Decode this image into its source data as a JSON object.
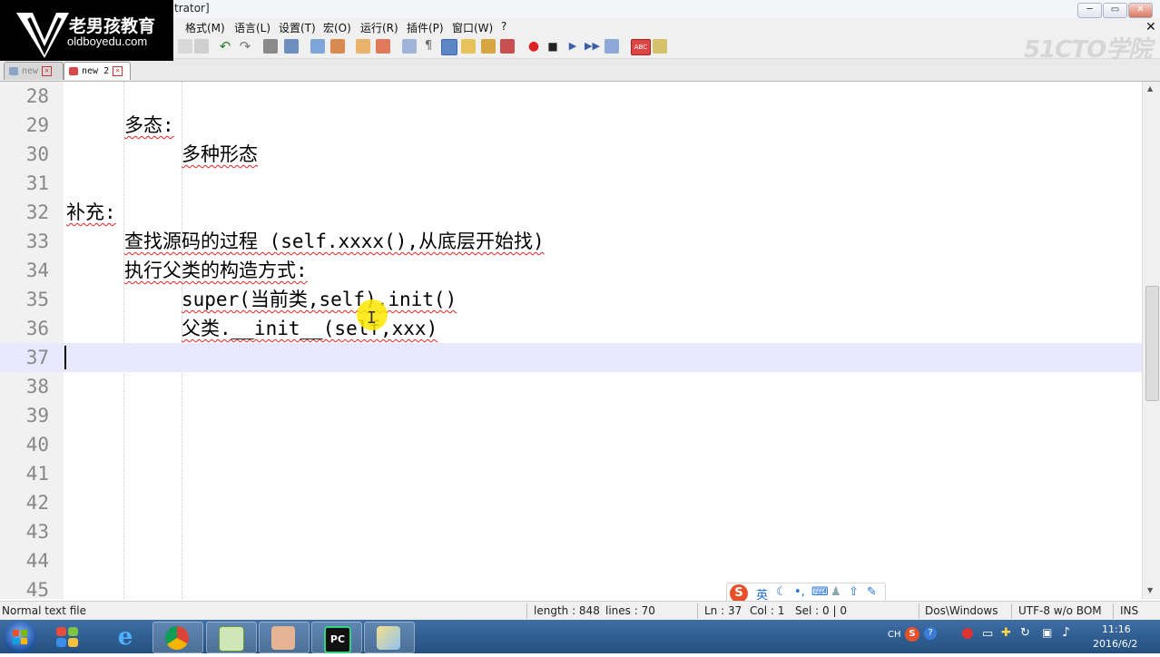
{
  "window": {
    "title_fragment": "trator]",
    "controls": [
      "─",
      "▭",
      "✕"
    ]
  },
  "logos": {
    "oldboy_cn": "老男孩教育",
    "oldboy_url": "oldboyedu.com",
    "cto": "51CTO学院"
  },
  "menu": [
    "格式(M)",
    "语言(L)",
    "设置(T)",
    "宏(O)",
    "运行(R)",
    "插件(P)",
    "窗口(W)",
    "?"
  ],
  "tabs": [
    {
      "label": "new",
      "active": false
    },
    {
      "label": "new  2",
      "active": true
    }
  ],
  "editor": {
    "lines": [
      {
        "n": "28",
        "text": ""
      },
      {
        "n": "29",
        "text": "多态:"
      },
      {
        "n": "30",
        "text": "多种形态"
      },
      {
        "n": "31",
        "text": ""
      },
      {
        "n": "32",
        "text": "补充:"
      },
      {
        "n": "33",
        "text": "查找源码的过程 (self.xxxx(),从底层开始找)"
      },
      {
        "n": "34",
        "text": "执行父类的构造方式:"
      },
      {
        "n": "35",
        "text": "super(当前类,self).init()"
      },
      {
        "n": "36",
        "text": "父类.__init__(self,xxx)"
      },
      {
        "n": "37",
        "text": ""
      },
      {
        "n": "38",
        "text": ""
      },
      {
        "n": "39",
        "text": ""
      },
      {
        "n": "40",
        "text": ""
      },
      {
        "n": "41",
        "text": ""
      },
      {
        "n": "42",
        "text": ""
      },
      {
        "n": "43",
        "text": ""
      },
      {
        "n": "44",
        "text": ""
      },
      {
        "n": "45",
        "text": ""
      }
    ],
    "current_line": "37"
  },
  "ime": {
    "mode": "英",
    "icons": [
      "moon-icon",
      "comma-icon",
      "keyboard-icon",
      "user-icon",
      "shirt-icon",
      "wrench-icon"
    ]
  },
  "status": {
    "file_type": "Normal text file",
    "length": "length : 848",
    "lines": "lines : 70",
    "ln": "Ln : 37",
    "col": "Col : 1",
    "sel": "Sel : 0 | 0",
    "eol": "Dos\\Windows",
    "encoding": "UTF-8 w/o BOM",
    "mode": "INS"
  },
  "taskbar": {
    "apps": [
      "ie-icon",
      "chrome-icon",
      "notepad-icon",
      "people-icon",
      "pycharm-icon",
      "paint-icon"
    ],
    "lang": "CH",
    "time": "11:16",
    "date": "2016/6/2"
  },
  "colors": {
    "current_line": "#e8e8ff",
    "squiggle": "#e22222",
    "taskbar": "#2f5f95"
  }
}
